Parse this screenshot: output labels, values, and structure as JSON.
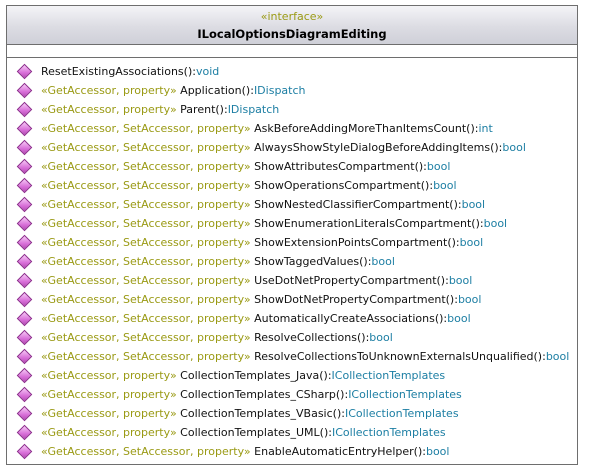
{
  "header": {
    "stereotype": "«interface»",
    "class_name": "ILocalOptionsDiagramEditing"
  },
  "operations": [
    {
      "stereo": "",
      "name": "ResetExistingAssociations()",
      "ret": "void"
    },
    {
      "stereo": "«GetAccessor, property»",
      "name": "Application()",
      "ret": "IDispatch"
    },
    {
      "stereo": "«GetAccessor, property»",
      "name": "Parent()",
      "ret": "IDispatch"
    },
    {
      "stereo": "«GetAccessor, SetAccessor, property»",
      "name": "AskBeforeAddingMoreThanItemsCount()",
      "ret": "int"
    },
    {
      "stereo": "«GetAccessor, SetAccessor, property»",
      "name": "AlwaysShowStyleDialogBeforeAddingItems()",
      "ret": "bool"
    },
    {
      "stereo": "«GetAccessor, SetAccessor, property»",
      "name": "ShowAttributesCompartment()",
      "ret": "bool"
    },
    {
      "stereo": "«GetAccessor, SetAccessor, property»",
      "name": "ShowOperationsCompartment()",
      "ret": "bool"
    },
    {
      "stereo": "«GetAccessor, SetAccessor, property»",
      "name": "ShowNestedClassifierCompartment()",
      "ret": "bool"
    },
    {
      "stereo": "«GetAccessor, SetAccessor, property»",
      "name": "ShowEnumerationLiteralsCompartment()",
      "ret": "bool"
    },
    {
      "stereo": "«GetAccessor, SetAccessor, property»",
      "name": "ShowExtensionPointsCompartment()",
      "ret": "bool"
    },
    {
      "stereo": "«GetAccessor, SetAccessor, property»",
      "name": "ShowTaggedValues()",
      "ret": "bool"
    },
    {
      "stereo": "«GetAccessor, SetAccessor, property»",
      "name": "UseDotNetPropertyCompartment()",
      "ret": "bool"
    },
    {
      "stereo": "«GetAccessor, SetAccessor, property»",
      "name": "ShowDotNetPropertyCompartment()",
      "ret": "bool"
    },
    {
      "stereo": "«GetAccessor, SetAccessor, property»",
      "name": "AutomaticallyCreateAssociations()",
      "ret": "bool"
    },
    {
      "stereo": "«GetAccessor, SetAccessor, property»",
      "name": "ResolveCollections()",
      "ret": "bool"
    },
    {
      "stereo": "«GetAccessor, SetAccessor, property»",
      "name": "ResolveCollectionsToUnknownExternalsUnqualified()",
      "ret": "bool"
    },
    {
      "stereo": "«GetAccessor, property»",
      "name": "CollectionTemplates_Java()",
      "ret": "ICollectionTemplates"
    },
    {
      "stereo": "«GetAccessor, property»",
      "name": "CollectionTemplates_CSharp()",
      "ret": "ICollectionTemplates"
    },
    {
      "stereo": "«GetAccessor, property»",
      "name": "CollectionTemplates_VBasic()",
      "ret": "ICollectionTemplates"
    },
    {
      "stereo": "«GetAccessor, property»",
      "name": "CollectionTemplates_UML()",
      "ret": "ICollectionTemplates"
    },
    {
      "stereo": "«GetAccessor, SetAccessor, property»",
      "name": "EnableAutomaticEntryHelper()",
      "ret": "bool"
    }
  ]
}
